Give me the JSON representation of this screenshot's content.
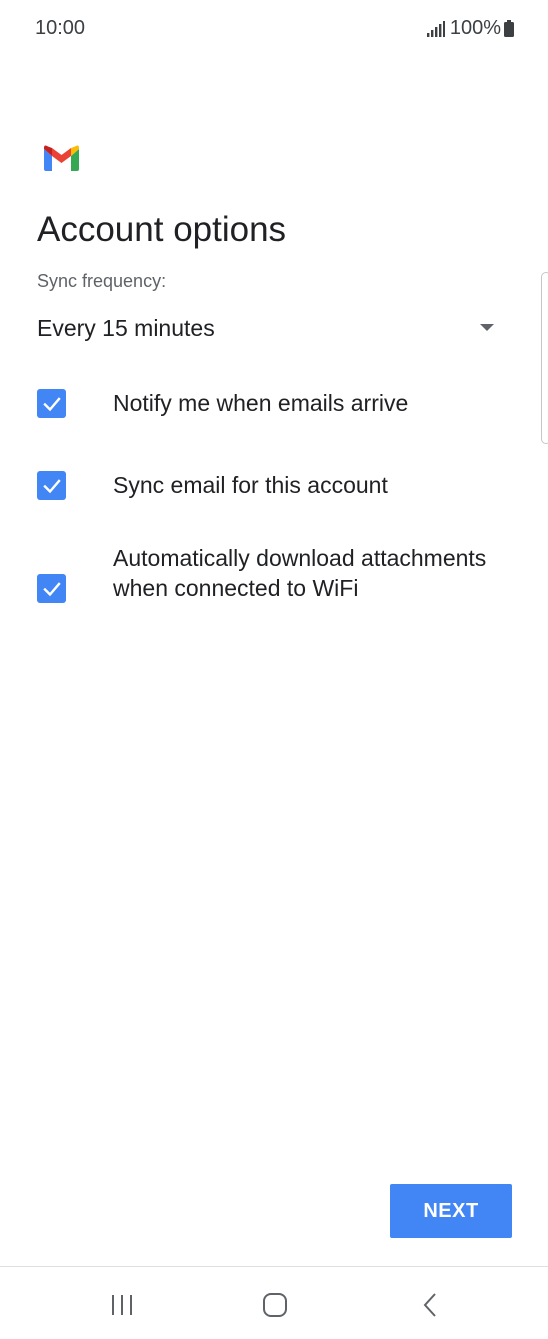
{
  "status_bar": {
    "time": "10:00",
    "battery": "100%",
    "signal_icon": "signal-icon",
    "battery_icon": "battery-icon"
  },
  "header": {
    "logo_icon": "gmail-logo-icon",
    "title": "Account options"
  },
  "sync": {
    "label": "Sync frequency:",
    "selected": "Every 15 minutes",
    "icon": "dropdown-arrow-icon"
  },
  "options": [
    {
      "label": "Notify me when emails arrive",
      "checked": true
    },
    {
      "label": "Sync email for this account",
      "checked": true
    },
    {
      "label": "Automatically download attachments when connected to WiFi",
      "checked": true
    }
  ],
  "actions": {
    "next_label": "NEXT"
  },
  "nav_bar": {
    "recents_icon": "recents-icon",
    "home_icon": "home-icon",
    "back_icon": "back-icon"
  },
  "colors": {
    "accent": "#4285f4",
    "text_primary": "#202124",
    "text_secondary": "#5f6368"
  }
}
